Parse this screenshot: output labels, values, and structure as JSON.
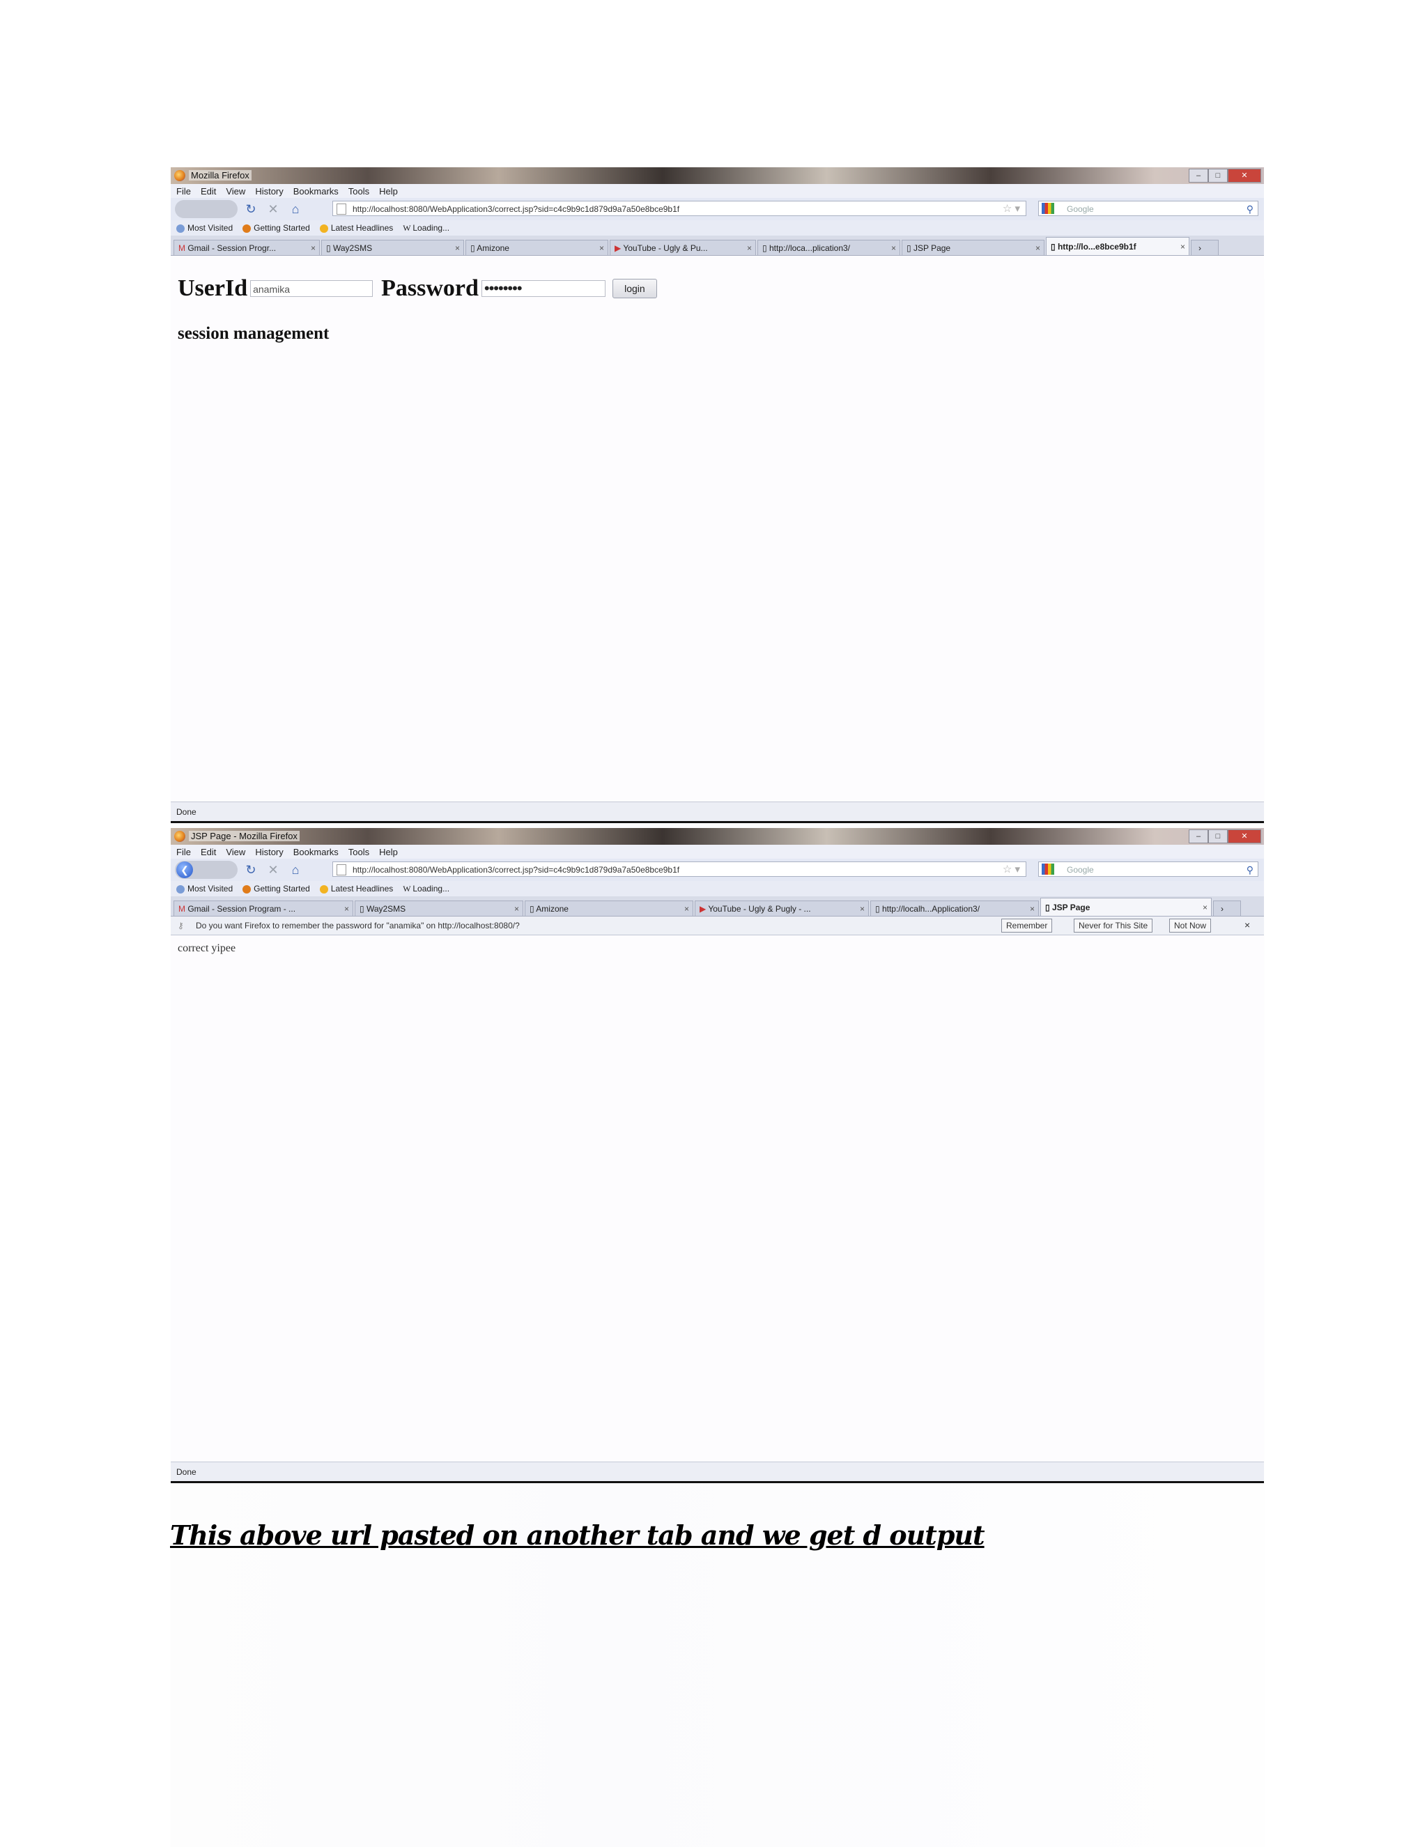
{
  "screenshot1": {
    "window_title": "Mozilla Firefox",
    "menu": [
      "File",
      "Edit",
      "View",
      "History",
      "Bookmarks",
      "Tools",
      "Help"
    ],
    "url": "http://localhost:8080/WebApplication3/correct.jsp?sid=c4c9b9c1d879d9a7a50e8bce9b1f",
    "search_placeholder": "Google",
    "bookmarks": [
      "Most Visited",
      "Getting Started",
      "Latest Headlines",
      "Loading..."
    ],
    "tabs": [
      {
        "label": "Gmail - Session Progr..."
      },
      {
        "label": "Way2SMS"
      },
      {
        "label": "Amizone"
      },
      {
        "label": "YouTube - Ugly & Pu..."
      },
      {
        "label": "http://loca...plication3/"
      },
      {
        "label": "JSP Page"
      },
      {
        "label": "http://lo...e8bce9b1f"
      }
    ],
    "form": {
      "userid_label": "UserId",
      "userid_value": "anamika",
      "password_label": "Password",
      "password_value": "••••••••",
      "login_label": "login"
    },
    "session_text": "session management",
    "status": "Done"
  },
  "screenshot2": {
    "window_title": "JSP Page - Mozilla Firefox",
    "menu": [
      "File",
      "Edit",
      "View",
      "History",
      "Bookmarks",
      "Tools",
      "Help"
    ],
    "url": "http://localhost:8080/WebApplication3/correct.jsp?sid=c4c9b9c1d879d9a7a50e8bce9b1f",
    "search_placeholder": "Google",
    "bookmarks": [
      "Most Visited",
      "Getting Started",
      "Latest Headlines",
      "Loading..."
    ],
    "tabs": [
      {
        "label": "Gmail - Session Program - ..."
      },
      {
        "label": "Way2SMS"
      },
      {
        "label": "Amizone"
      },
      {
        "label": "YouTube - Ugly & Pugly - ..."
      },
      {
        "label": "http://localh...Application3/"
      },
      {
        "label": "JSP Page"
      }
    ],
    "notification": {
      "text": "Do you want Firefox to remember the password for \"anamika\" on http://localhost:8080/?",
      "remember": "Remember",
      "never": "Never for This Site",
      "not_now": "Not Now",
      "close": "×"
    },
    "result_text": "correct yipee",
    "status": "Done"
  },
  "caption": "This above url pasted on another tab and we get d output"
}
